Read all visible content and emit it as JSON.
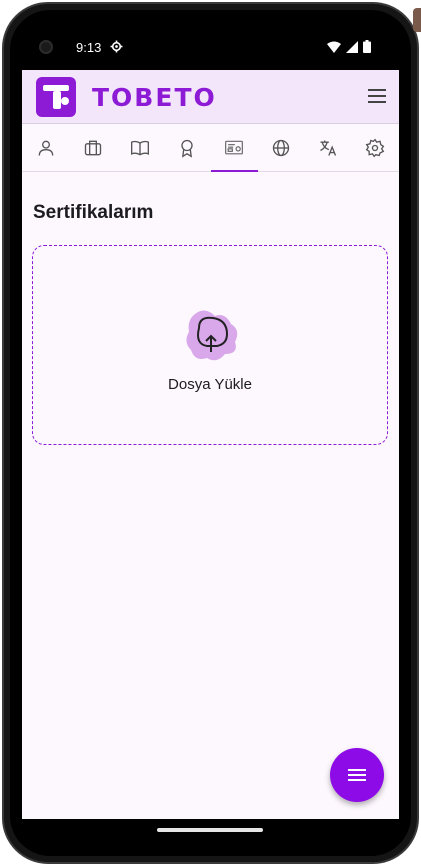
{
  "status_bar": {
    "time": "9:13"
  },
  "app_bar": {
    "logo_text": "TOBETO",
    "brand_color": "#8d1bd6"
  },
  "tabs": [
    {
      "icon": "person-icon",
      "active": false
    },
    {
      "icon": "briefcase-icon",
      "active": false
    },
    {
      "icon": "book-icon",
      "active": false
    },
    {
      "icon": "award-icon",
      "active": false
    },
    {
      "icon": "certificate-icon",
      "active": true
    },
    {
      "icon": "globe-icon",
      "active": false
    },
    {
      "icon": "translate-icon",
      "active": false
    },
    {
      "icon": "settings-icon",
      "active": false
    }
  ],
  "main": {
    "title": "Sertifikalarım",
    "upload_label": "Dosya Yükle"
  }
}
